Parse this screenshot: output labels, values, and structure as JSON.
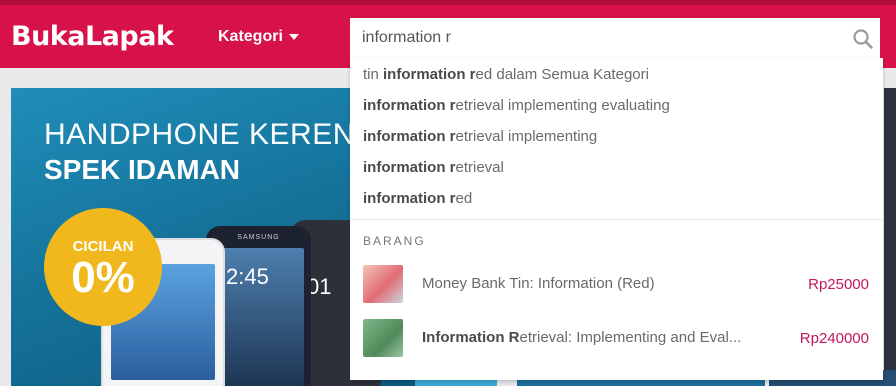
{
  "header": {
    "logo": "BukaLapak",
    "category_label": "Kategori",
    "colors": {
      "brand": "#d71149",
      "price": "#c2185b"
    }
  },
  "search": {
    "value": "information r",
    "icon": "search-icon"
  },
  "suggestions": [
    {
      "prefix": "tin ",
      "bold": "information r",
      "rest": "ed dalam Semua Kategori"
    },
    {
      "prefix": "",
      "bold": "information r",
      "rest": "etrieval implementing evaluating"
    },
    {
      "prefix": "",
      "bold": "information r",
      "rest": "etrieval implementing"
    },
    {
      "prefix": "",
      "bold": "information r",
      "rest": "etrieval"
    },
    {
      "prefix": "",
      "bold": "information r",
      "rest": "ed"
    }
  ],
  "products_section_label": "BARANG",
  "products": [
    {
      "prefix": "Money Bank Tin: Information (Red)",
      "bold": "",
      "rest": "",
      "price": "Rp25000",
      "thumb_color": "#e26b75"
    },
    {
      "prefix": "",
      "bold": "Information R",
      "rest": "etrieval: Implementing and Eval...",
      "price": "Rp240000",
      "thumb_color": "#4f8a5a"
    }
  ],
  "banner": {
    "line1": "HANDPHONE KEREN",
    "line2": "SPEK IDAMAN",
    "badge_line1": "CICILAN",
    "badge_line2": "0%",
    "phone_brand": "SAMSUNG",
    "phone_time": "2:45",
    "phone_time2": "01"
  }
}
